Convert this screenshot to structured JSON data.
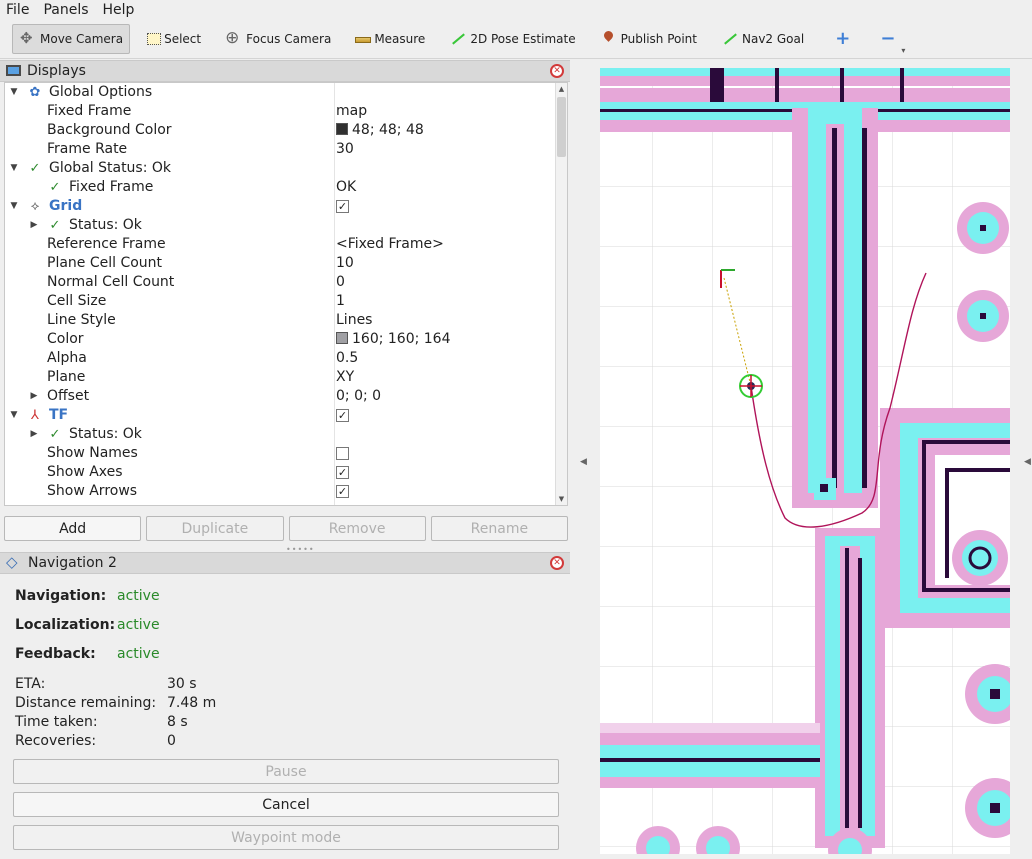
{
  "menu": [
    "File",
    "Panels",
    "Help"
  ],
  "toolbar": {
    "move_camera": "Move Camera",
    "select": "Select",
    "focus_camera": "Focus Camera",
    "measure": "Measure",
    "pose_estimate": "2D Pose Estimate",
    "publish_point": "Publish Point",
    "nav2_goal": "Nav2 Goal",
    "add_tool": "+",
    "remove_tool": "−"
  },
  "displays": {
    "title": "Displays",
    "rows": [
      {
        "label": "Global Options",
        "value": ""
      },
      {
        "label": "Fixed Frame",
        "value": "map"
      },
      {
        "label": "Background Color",
        "value": "48; 48; 48"
      },
      {
        "label": "Frame Rate",
        "value": "30"
      },
      {
        "label": "Global Status: Ok",
        "value": ""
      },
      {
        "label": "Fixed Frame",
        "value": "OK"
      },
      {
        "label": "Grid",
        "value": ""
      },
      {
        "label": "Status: Ok",
        "value": ""
      },
      {
        "label": "Reference Frame",
        "value": "<Fixed Frame>"
      },
      {
        "label": "Plane Cell Count",
        "value": "10"
      },
      {
        "label": "Normal Cell Count",
        "value": "0"
      },
      {
        "label": "Cell Size",
        "value": "1"
      },
      {
        "label": "Line Style",
        "value": "Lines"
      },
      {
        "label": "Color",
        "value": "160; 160; 164"
      },
      {
        "label": "Alpha",
        "value": "0.5"
      },
      {
        "label": "Plane",
        "value": "XY"
      },
      {
        "label": "Offset",
        "value": "0; 0; 0"
      },
      {
        "label": "TF",
        "value": ""
      },
      {
        "label": "Status: Ok",
        "value": ""
      },
      {
        "label": "Show Names",
        "value": ""
      },
      {
        "label": "Show Axes",
        "value": ""
      },
      {
        "label": "Show Arrows",
        "value": ""
      }
    ],
    "bg_swatch": "#303030",
    "grid_swatch": "#a0a0a4"
  },
  "buttons": {
    "add": "Add",
    "duplicate": "Duplicate",
    "remove": "Remove",
    "rename": "Rename"
  },
  "nav2": {
    "title": "Navigation 2",
    "navigation_label": "Navigation:",
    "navigation_value": "active",
    "localization_label": "Localization:",
    "localization_value": "active",
    "feedback_label": "Feedback:",
    "feedback_value": "active",
    "eta_label": "ETA:",
    "eta_value": "30 s",
    "distance_label": "Distance remaining:",
    "distance_value": "7.48 m",
    "time_label": "Time taken:",
    "time_value": "8 s",
    "recoveries_label": "Recoveries:",
    "recoveries_value": "0",
    "pause": "Pause",
    "cancel": "Cancel",
    "waypoint": "Waypoint mode"
  },
  "colors": {
    "active_green": "#2a8a2a",
    "costmap_pink": "#e6a7d8",
    "costmap_cyan": "#7af0f0",
    "wall": "#2a0a3a",
    "path": "#b0145a"
  }
}
